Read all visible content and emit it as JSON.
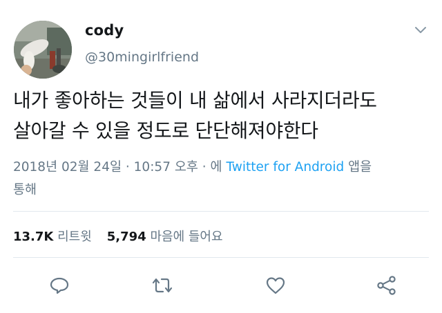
{
  "tweet": {
    "author": {
      "name": "cody",
      "handle": "@30mingirlfriend"
    },
    "text_lines": [
      "내가 좋아하는 것들이 내 삶에서 사라지더라도",
      "살아갈 수 있을 정도로 단단해져야한다"
    ],
    "meta": {
      "date": "2018년 02월 24일",
      "separator": "·",
      "time": "10:57 오후",
      "via_prefix": "· 에",
      "source": "Twitter for Android",
      "via_suffix": "앱을",
      "suffix_line2": "통해"
    },
    "stats": {
      "retweets_count": "13.7K",
      "retweets_label": "리트윗",
      "likes_count": "5,794",
      "likes_label": "마음에 들어요"
    },
    "actions": [
      "reply-icon",
      "retweet-icon",
      "like-icon",
      "share-icon"
    ],
    "colors": {
      "link": "#1da1f2",
      "secondary_text": "#657786",
      "primary_text": "#14171a",
      "divider": "#e1e8ed"
    }
  }
}
